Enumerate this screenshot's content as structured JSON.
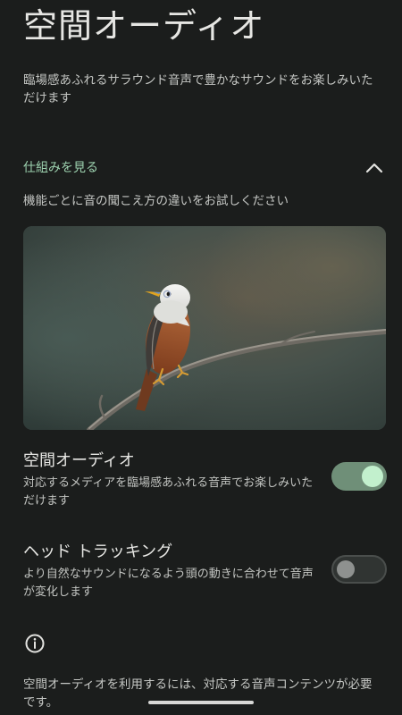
{
  "page": {
    "title": "空間オーディオ",
    "intro": "臨場感あふれるサラウンド音声で豊かなサウンドをお楽しみいただけます"
  },
  "expander": {
    "label": "仕組みを見る",
    "icon": "chevron-up-icon",
    "description": "機能ごとに音の聞こえ方の違いをお試しください",
    "accent": "#9ed3b0"
  },
  "media": {
    "icon": "bird-on-branch-image"
  },
  "settings": {
    "spatial_audio": {
      "title": "空間オーディオ",
      "subtitle": "対応するメディアを臨場感あふれる音声でお楽しみいただけます",
      "enabled": true,
      "track_color": "#6f8f78",
      "thumb_color": "#c2f0cd"
    },
    "head_tracking": {
      "title": "ヘッド トラッキング",
      "subtitle": "より自然なサウンドになるよう頭の動きに合わせて音声が変化します",
      "enabled": false
    }
  },
  "footer": {
    "icon": "info-icon",
    "note": "空間オーディオを利用するには、対応する音声コンテンツが必要です。"
  }
}
